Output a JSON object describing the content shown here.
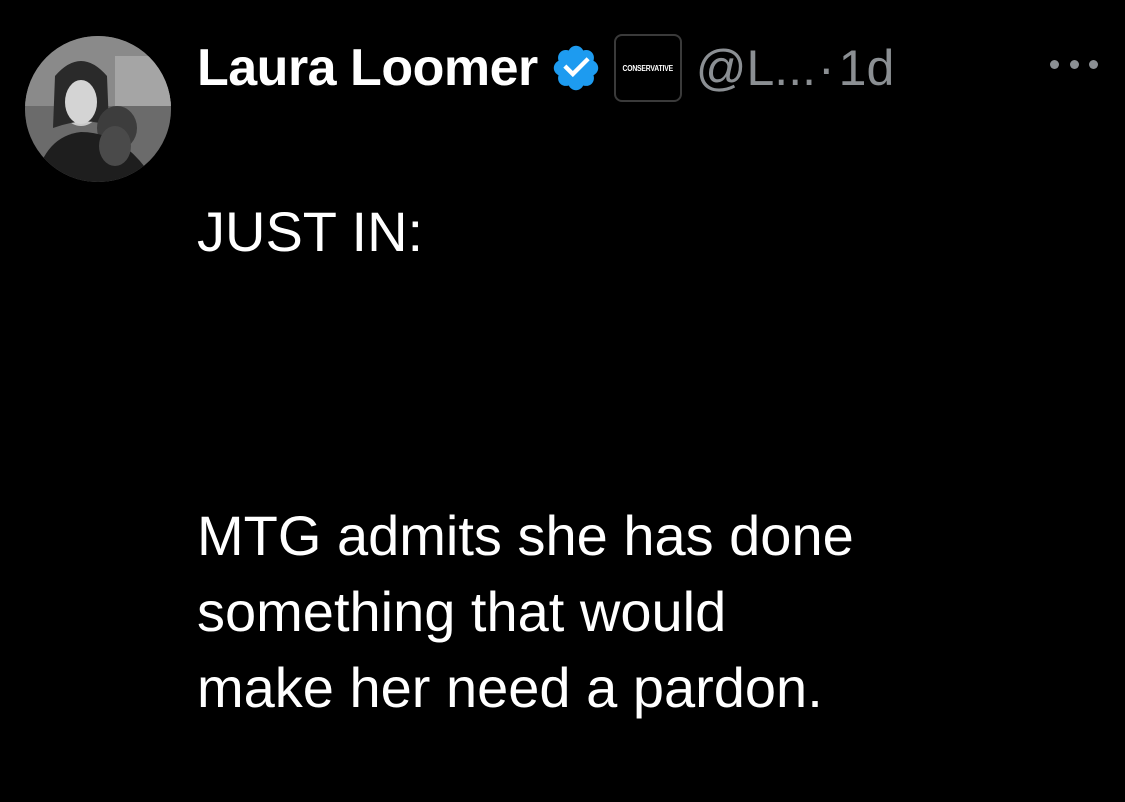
{
  "tweet": {
    "author": {
      "display_name": "Laura Loomer",
      "handle": "@L...",
      "verified_icon": "verified-badge-icon",
      "affiliate_badge_text": "CONSERVATIVE",
      "verified_color": "#1d9bf0"
    },
    "separator": "·",
    "time": "1d",
    "more_icon": "more-horizontal-icon",
    "text_line1": "JUST IN:",
    "text_line2": "MTG admits she has done\nsomething that would\nmake her need a pardon."
  },
  "colors": {
    "background": "#000000",
    "text": "#ffffff",
    "secondary_text": "#8b8f93"
  }
}
